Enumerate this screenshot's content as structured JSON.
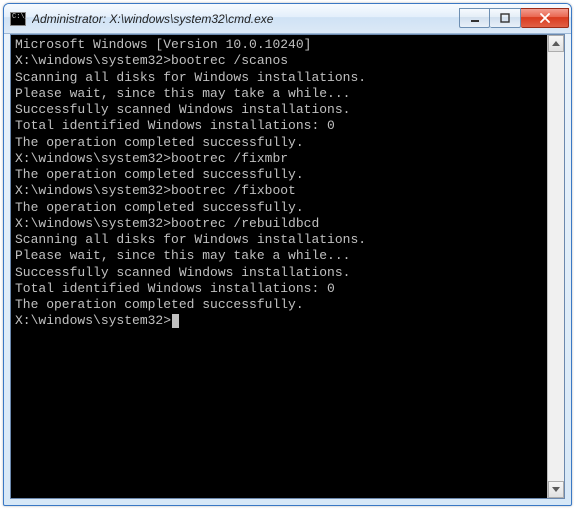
{
  "window": {
    "title": "Administrator: X:\\windows\\system32\\cmd.exe"
  },
  "terminal": {
    "version_line": "Microsoft Windows [Version 10.0.10240]",
    "prompt": "X:\\windows\\system32>",
    "blocks": [
      {
        "command": "bootrec /scanos",
        "output": [
          "Scanning all disks for Windows installations.",
          "",
          "Please wait, since this may take a while...",
          "",
          "Successfully scanned Windows installations.",
          "Total identified Windows installations: 0",
          "The operation completed successfully."
        ]
      },
      {
        "command": "bootrec /fixmbr",
        "output": [
          "The operation completed successfully."
        ]
      },
      {
        "command": "bootrec /fixboot",
        "output": [
          "The operation completed successfully."
        ]
      },
      {
        "command": "bootrec /rebuildbcd",
        "output": [
          "Scanning all disks for Windows installations.",
          "",
          "Please wait, since this may take a while...",
          "",
          "Successfully scanned Windows installations.",
          "Total identified Windows installations: 0",
          "The operation completed successfully."
        ]
      }
    ],
    "trailing_prompt": "X:\\windows\\system32>"
  }
}
